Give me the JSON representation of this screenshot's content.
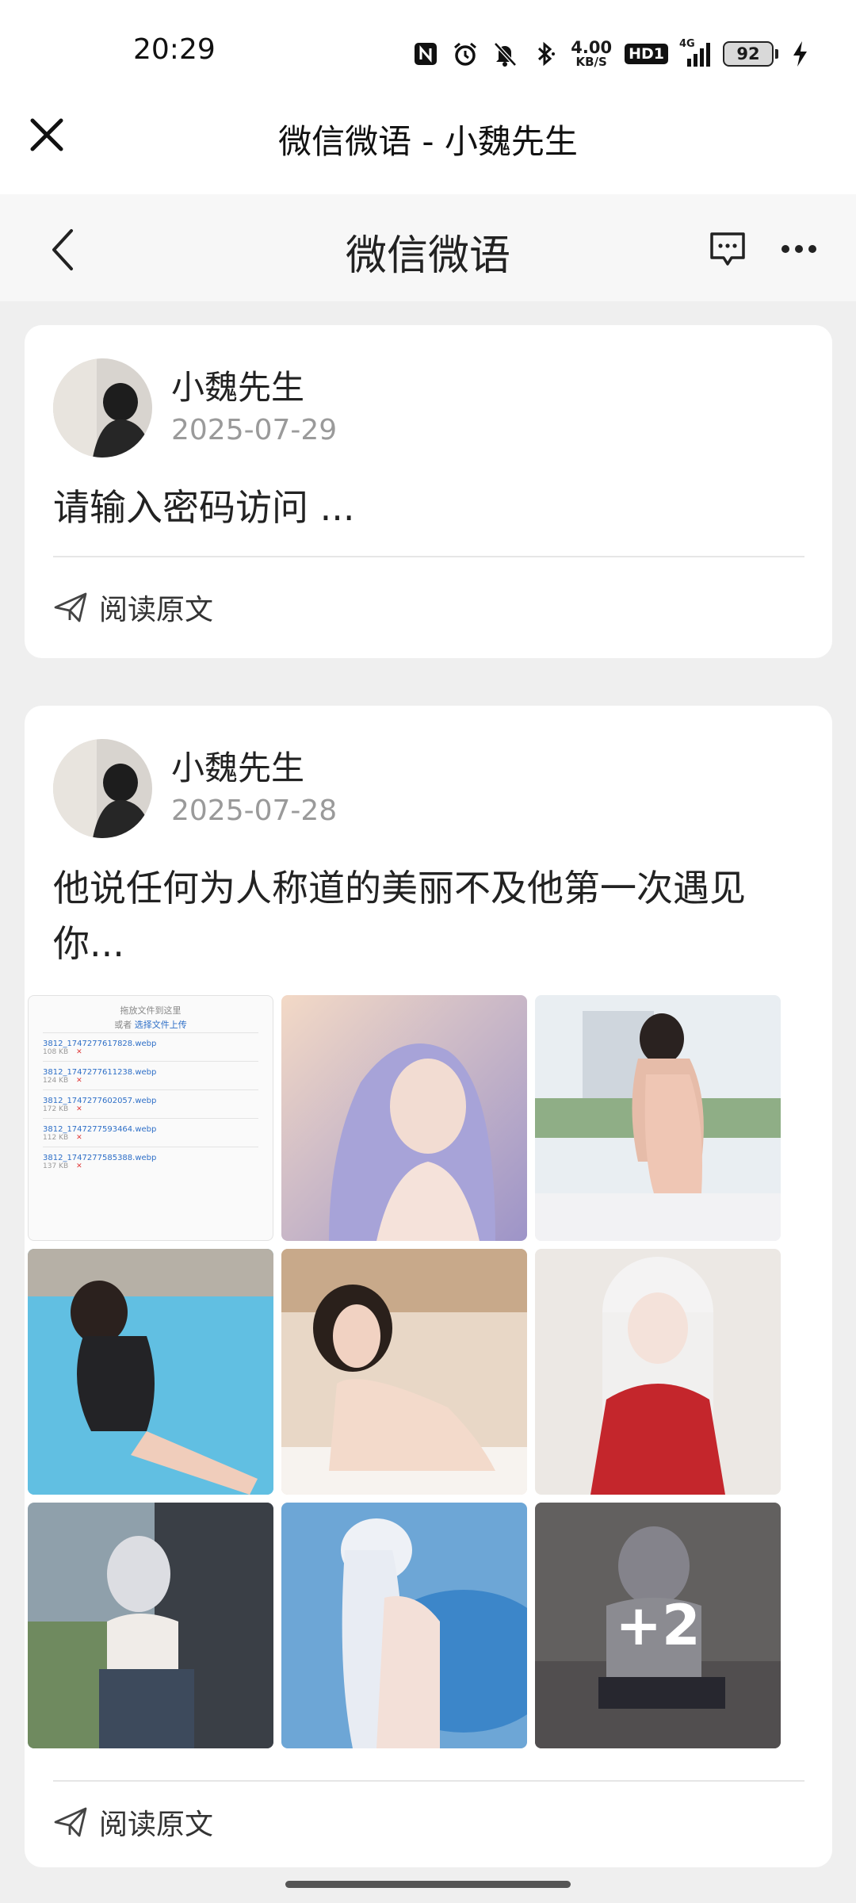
{
  "status_bar": {
    "time": "20:29",
    "net_speed_value": "4.00",
    "net_speed_unit": "KB/S",
    "hd_badge": "HD1",
    "signal_tag": "4G",
    "battery": "92"
  },
  "title_bar": {
    "title": "微信微语 - 小魏先生"
  },
  "nav_bar": {
    "title": "微信微语"
  },
  "posts": [
    {
      "author": "小魏先生",
      "date": "2025-07-29",
      "excerpt": "请输入密码访问 ...",
      "read_more": "阅读原文"
    },
    {
      "author": "小魏先生",
      "date": "2025-07-28",
      "excerpt": "他说任何为人称道的美丽不及他第一次遇见你...",
      "read_more": "阅读原文",
      "more_images": "+2",
      "upload_panel": {
        "header_line1": "拖放文件到这里",
        "header_line2_prefix": "或者",
        "header_line2_link": "选择文件上传",
        "files": [
          {
            "name": "3812_1747277617828.webp",
            "size": "108 KB"
          },
          {
            "name": "3812_1747277611238.webp",
            "size": "124 KB"
          },
          {
            "name": "3812_1747277602057.webp",
            "size": "172 KB"
          },
          {
            "name": "3812_1747277593464.webp",
            "size": "112 KB"
          },
          {
            "name": "3812_1747277585388.webp",
            "size": "137 KB"
          }
        ]
      }
    }
  ],
  "colors": {
    "background": "#efefef",
    "card": "#ffffff",
    "muted_text": "#9a9a9a",
    "link_blue": "#2e6fc7"
  }
}
